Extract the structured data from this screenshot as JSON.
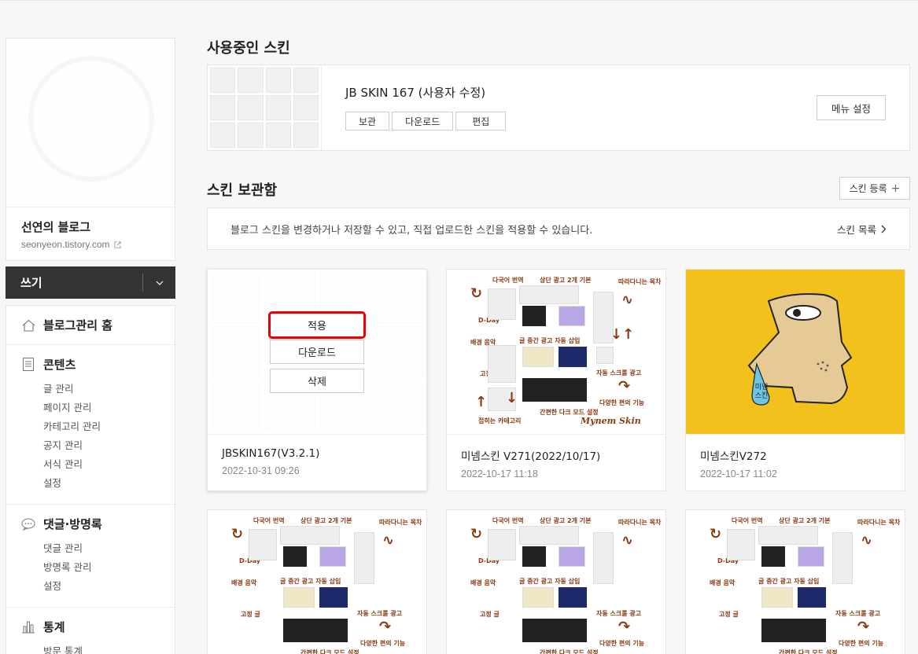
{
  "sidebar": {
    "blog_name": "선연의 블로그",
    "blog_url": "seonyeon.tistory.com",
    "write_label": "쓰기",
    "menu": [
      {
        "label": "블로그관리 홈",
        "icon": "home-icon",
        "subs": []
      },
      {
        "label": "콘텐츠",
        "icon": "document-icon",
        "subs": [
          "글 관리",
          "페이지 관리",
          "카테고리 관리",
          "공지 관리",
          "서식 관리",
          "설정"
        ]
      },
      {
        "label": "댓글·방명록",
        "icon": "speech-bubble-icon",
        "subs": [
          "댓글 관리",
          "방명록 관리",
          "설정"
        ]
      },
      {
        "label": "통계",
        "icon": "bar-chart-icon",
        "subs": [
          "방문 통계"
        ]
      }
    ]
  },
  "current_skin": {
    "heading": "사용중인 스킨",
    "name": "JB SKIN 167 (사용자 수정)",
    "buttons": [
      "보관",
      "다운로드",
      "편집"
    ],
    "menu_setting": "메뉴 설정"
  },
  "storage": {
    "heading": "스킨 보관함",
    "register_label": "스킨 등록",
    "notice": "블로그 스킨을 변경하거나 저장할 수 있고, 직접 업로드한 스킨을 적용할 수 있습니다.",
    "list_link": "스킨 목록"
  },
  "overlay": {
    "apply": "적용",
    "download": "다운로드",
    "delete": "삭제"
  },
  "promo": {
    "labels": [
      "다국어 번역",
      "상단 광고 2개 기본",
      "따라다니는 목차",
      "D-Day",
      "배경 음악",
      "글 중간 광고 자동 삽입",
      "고정 글",
      "자동 스크롤 광고",
      "다양한 편의 기능",
      "간편한 다크 모드 설정",
      "접히는 카테고리"
    ],
    "brand": "Mynem Skin",
    "badge": "미넴 스킨"
  },
  "cards": [
    {
      "name": "JBSKIN167(V3.2.1)",
      "date": "2022-10-31 09:26"
    },
    {
      "name": "미넴스킨 V271(2022/10/17)",
      "date": "2022-10-17 11:18"
    },
    {
      "name": "미넴스킨V272",
      "date": "2022-10-17 11:02"
    }
  ],
  "colors": {
    "accent_red": "#ee0000",
    "dark": "#333333",
    "yellow": "#f2c11c"
  }
}
